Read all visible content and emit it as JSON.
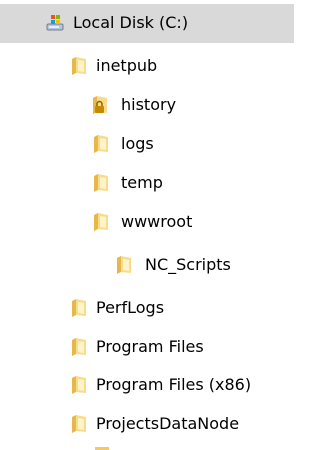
{
  "tree": {
    "items": [
      {
        "label": "Local Disk (C:)",
        "icon": "drive-icon",
        "selected": true,
        "depth": 0
      },
      {
        "label": "inetpub",
        "icon": "folder-icon",
        "selected": false,
        "depth": 1
      },
      {
        "label": "history",
        "icon": "locked-folder-icon",
        "selected": false,
        "depth": 2
      },
      {
        "label": "logs",
        "icon": "folder-icon",
        "selected": false,
        "depth": 2
      },
      {
        "label": "temp",
        "icon": "folder-icon",
        "selected": false,
        "depth": 2
      },
      {
        "label": "wwwroot",
        "icon": "folder-icon",
        "selected": false,
        "depth": 2
      },
      {
        "label": "NC_Scripts",
        "icon": "folder-icon",
        "selected": false,
        "depth": 3
      },
      {
        "label": "PerfLogs",
        "icon": "folder-icon",
        "selected": false,
        "depth": 1
      },
      {
        "label": "Program Files",
        "icon": "folder-icon",
        "selected": false,
        "depth": 1
      },
      {
        "label": "Program Files (x86)",
        "icon": "folder-icon",
        "selected": false,
        "depth": 1
      },
      {
        "label": "ProjectsDataNode",
        "icon": "folder-icon",
        "selected": false,
        "depth": 1
      }
    ]
  },
  "colors": {
    "selected_background": "#d9d9d9",
    "folder_light": "#f7dc8c",
    "folder_dark": "#e7b74a",
    "lock_color": "#c48a00",
    "drive_body": "#b7c6d8"
  }
}
